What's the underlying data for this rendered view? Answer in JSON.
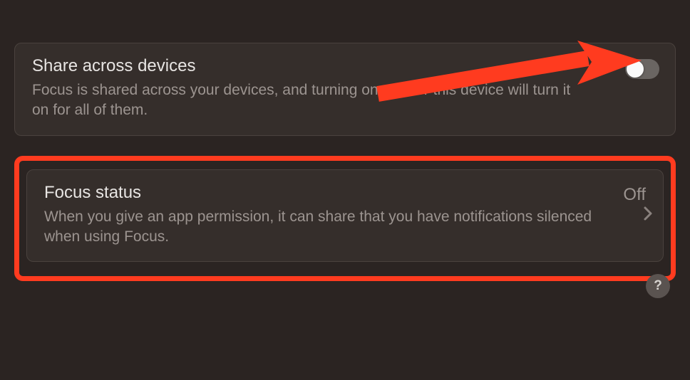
{
  "share_devices": {
    "title": "Share across devices",
    "description": "Focus is shared across your devices, and turning one on for this device will turn it on for all of them.",
    "toggle_state": "off"
  },
  "focus_status": {
    "title": "Focus status",
    "description": "When you give an app permission, it can share that you have notifications silenced when using Focus.",
    "value": "Off"
  },
  "help_label": "?",
  "colors": {
    "highlight": "#ff3b1f",
    "bg": "#2b2422",
    "card_bg": "#352e2b"
  }
}
